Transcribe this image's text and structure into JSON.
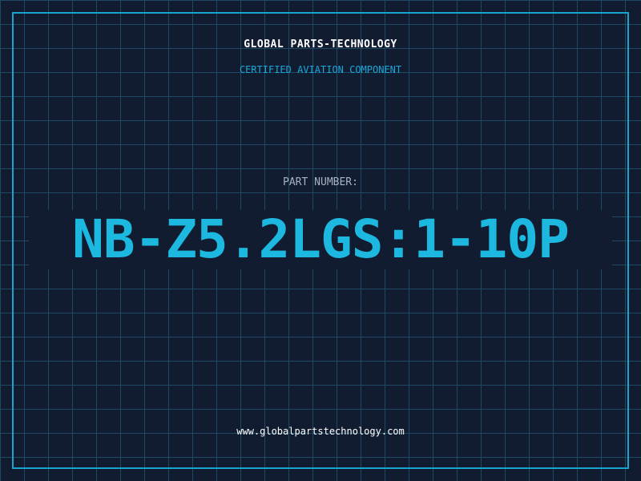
{
  "header": {
    "company": "GLOBAL PARTS-TECHNOLOGY",
    "tagline": "CERTIFIED AVIATION COMPONENT"
  },
  "part": {
    "label": "PART NUMBER:",
    "number": "NB-Z5.2LGS:1-10P"
  },
  "footer": {
    "url": "www.globalpartstechnology.com"
  },
  "colors": {
    "background": "#121c31",
    "grid": "#1f4a66",
    "accent": "#1db8e0",
    "frame": "#19a3cf",
    "label": "#a8b2c4",
    "text": "#ffffff"
  }
}
